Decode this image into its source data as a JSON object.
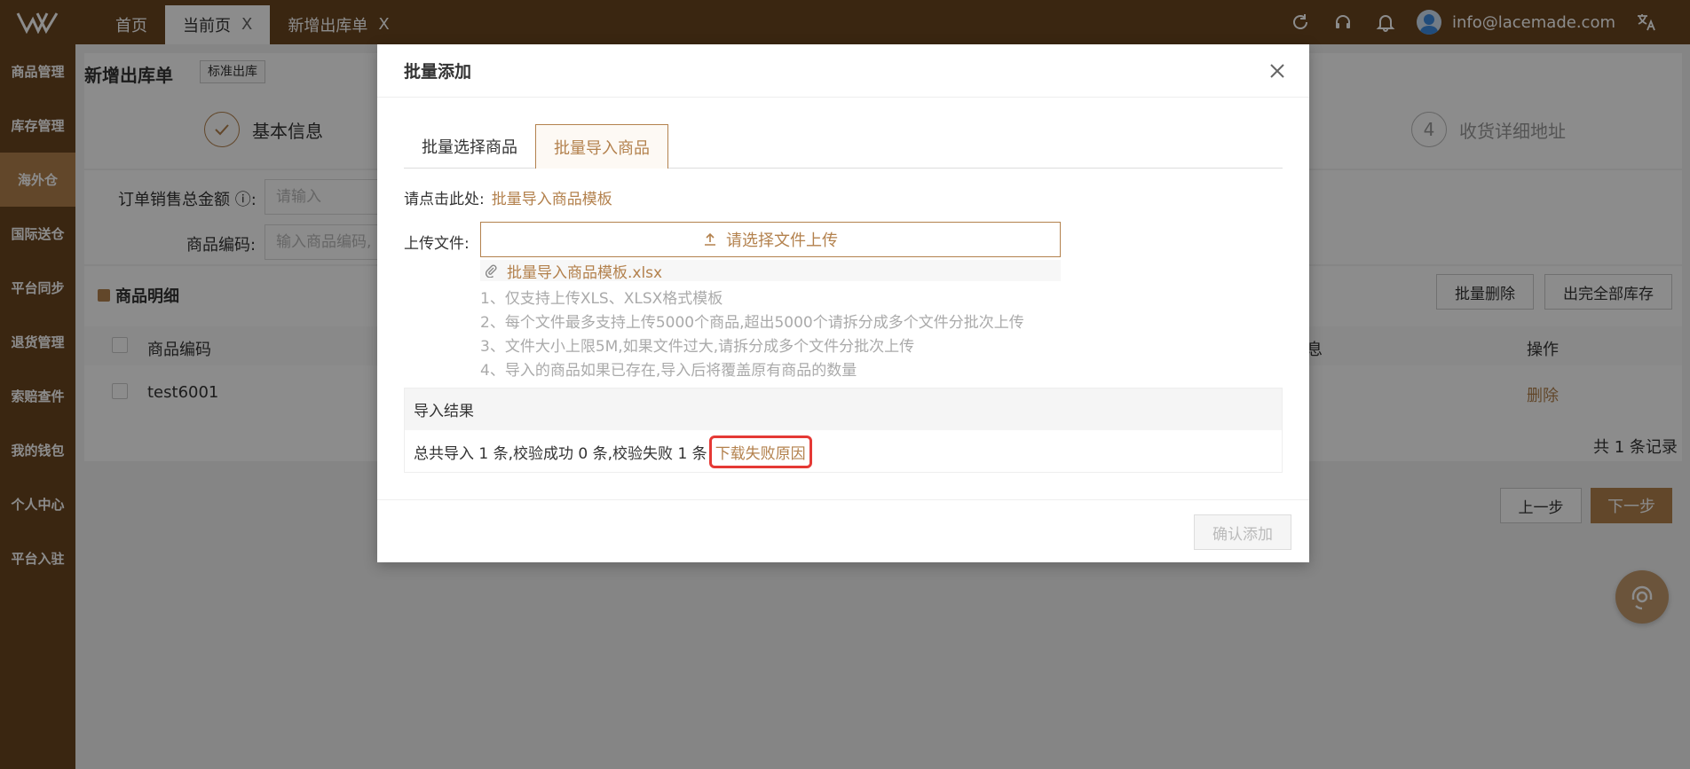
{
  "topbar": {
    "tabs": [
      {
        "label": "首页"
      },
      {
        "label": "当前页",
        "close": "X"
      },
      {
        "label": "新增出库单",
        "close": "X"
      }
    ],
    "user_email": "info@lacemade.com",
    "icons": [
      "refresh-icon",
      "headset-icon",
      "bell-icon",
      "avatar",
      "translate-icon"
    ]
  },
  "sidebar": {
    "items": [
      {
        "label": "商品管理"
      },
      {
        "label": "库存管理"
      },
      {
        "label": "海外仓"
      },
      {
        "label": "国际送仓"
      },
      {
        "label": "平台同步"
      },
      {
        "label": "退货管理"
      },
      {
        "label": "索赔查件"
      },
      {
        "label": "我的钱包"
      },
      {
        "label": "个人中心"
      },
      {
        "label": "平台入驻"
      }
    ]
  },
  "page": {
    "title": "新增出库单",
    "tag": "标准出库",
    "steps": [
      {
        "label": "基本信息"
      },
      {
        "number": "4",
        "label": "收货详细地址"
      }
    ],
    "form": {
      "amount_label": "订单销售总金额",
      "amount_placeholder": "请输入",
      "code_label": "商品编码:",
      "code_placeholder": "输入商品编码,"
    },
    "section_title": "商品明细",
    "actions": {
      "batch_delete": "批量删除",
      "all_out": "出完全部库存"
    },
    "table": {
      "headers": {
        "code": "商品编码",
        "info": "息",
        "op": "操作"
      },
      "rows": [
        {
          "code": "test6001",
          "op": "删除"
        }
      ]
    },
    "pager": "共 1 条记录",
    "prev": "上一步",
    "next": "下一步"
  },
  "modal": {
    "title": "批量添加",
    "tabs": [
      {
        "label": "批量选择商品"
      },
      {
        "label": "批量导入商品"
      }
    ],
    "template_prompt": "请点击此处:",
    "template_link": "批量导入商品模板",
    "upload_label": "上传文件:",
    "upload_button": "请选择文件上传",
    "file_name": "批量导入商品模板.xlsx",
    "notes": [
      "1、仅支持上传XLS、XLSX格式模板",
      "2、每个文件最多支持上传5000个商品,超出5000个请拆分成多个文件分批次上传",
      "3、文件大小上限5M,如果文件过大,请拆分成多个文件分批次上传",
      "4、导入的商品如果已存在,导入后将覆盖原有商品的数量"
    ],
    "result_title": "导入结果",
    "result_text": "总共导入 1 条,校验成功 0 条,校验失败 1 条",
    "download_link": "下载失败原因",
    "confirm": "确认添加"
  },
  "colors": {
    "brand": "#6b4520",
    "accent": "#b3814d",
    "highlight": "#e53935"
  }
}
